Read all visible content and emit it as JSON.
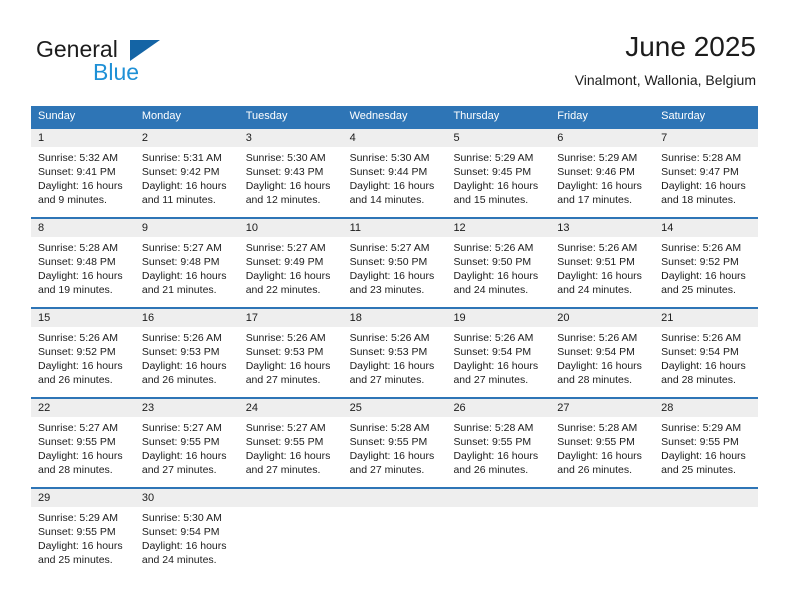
{
  "brand": {
    "name_top": "General",
    "name_bottom": "Blue",
    "mark": "triangle-logo-icon",
    "accent_top": "#1464a5",
    "accent_bottom": "#1e90d6"
  },
  "header": {
    "title": "June 2025",
    "subtitle": "Vinalmont, Wallonia, Belgium"
  },
  "theme": {
    "header_blue": "#2e75b6",
    "row_divider_blue": "#2e75b6",
    "daynum_band": "#eeeeee",
    "cell_background": "#ffffff",
    "text": "#1c1c1c"
  },
  "calendar": {
    "weekdays": [
      "Sunday",
      "Monday",
      "Tuesday",
      "Wednesday",
      "Thursday",
      "Friday",
      "Saturday"
    ],
    "weeks": [
      {
        "days": [
          {
            "num": "1",
            "l1": "Sunrise: 5:32 AM",
            "l2": "Sunset: 9:41 PM",
            "l3": "Daylight: 16 hours",
            "l4": "and 9 minutes."
          },
          {
            "num": "2",
            "l1": "Sunrise: 5:31 AM",
            "l2": "Sunset: 9:42 PM",
            "l3": "Daylight: 16 hours",
            "l4": "and 11 minutes."
          },
          {
            "num": "3",
            "l1": "Sunrise: 5:30 AM",
            "l2": "Sunset: 9:43 PM",
            "l3": "Daylight: 16 hours",
            "l4": "and 12 minutes."
          },
          {
            "num": "4",
            "l1": "Sunrise: 5:30 AM",
            "l2": "Sunset: 9:44 PM",
            "l3": "Daylight: 16 hours",
            "l4": "and 14 minutes."
          },
          {
            "num": "5",
            "l1": "Sunrise: 5:29 AM",
            "l2": "Sunset: 9:45 PM",
            "l3": "Daylight: 16 hours",
            "l4": "and 15 minutes."
          },
          {
            "num": "6",
            "l1": "Sunrise: 5:29 AM",
            "l2": "Sunset: 9:46 PM",
            "l3": "Daylight: 16 hours",
            "l4": "and 17 minutes."
          },
          {
            "num": "7",
            "l1": "Sunrise: 5:28 AM",
            "l2": "Sunset: 9:47 PM",
            "l3": "Daylight: 16 hours",
            "l4": "and 18 minutes."
          }
        ]
      },
      {
        "days": [
          {
            "num": "8",
            "l1": "Sunrise: 5:28 AM",
            "l2": "Sunset: 9:48 PM",
            "l3": "Daylight: 16 hours",
            "l4": "and 19 minutes."
          },
          {
            "num": "9",
            "l1": "Sunrise: 5:27 AM",
            "l2": "Sunset: 9:48 PM",
            "l3": "Daylight: 16 hours",
            "l4": "and 21 minutes."
          },
          {
            "num": "10",
            "l1": "Sunrise: 5:27 AM",
            "l2": "Sunset: 9:49 PM",
            "l3": "Daylight: 16 hours",
            "l4": "and 22 minutes."
          },
          {
            "num": "11",
            "l1": "Sunrise: 5:27 AM",
            "l2": "Sunset: 9:50 PM",
            "l3": "Daylight: 16 hours",
            "l4": "and 23 minutes."
          },
          {
            "num": "12",
            "l1": "Sunrise: 5:26 AM",
            "l2": "Sunset: 9:50 PM",
            "l3": "Daylight: 16 hours",
            "l4": "and 24 minutes."
          },
          {
            "num": "13",
            "l1": "Sunrise: 5:26 AM",
            "l2": "Sunset: 9:51 PM",
            "l3": "Daylight: 16 hours",
            "l4": "and 24 minutes."
          },
          {
            "num": "14",
            "l1": "Sunrise: 5:26 AM",
            "l2": "Sunset: 9:52 PM",
            "l3": "Daylight: 16 hours",
            "l4": "and 25 minutes."
          }
        ]
      },
      {
        "days": [
          {
            "num": "15",
            "l1": "Sunrise: 5:26 AM",
            "l2": "Sunset: 9:52 PM",
            "l3": "Daylight: 16 hours",
            "l4": "and 26 minutes."
          },
          {
            "num": "16",
            "l1": "Sunrise: 5:26 AM",
            "l2": "Sunset: 9:53 PM",
            "l3": "Daylight: 16 hours",
            "l4": "and 26 minutes."
          },
          {
            "num": "17",
            "l1": "Sunrise: 5:26 AM",
            "l2": "Sunset: 9:53 PM",
            "l3": "Daylight: 16 hours",
            "l4": "and 27 minutes."
          },
          {
            "num": "18",
            "l1": "Sunrise: 5:26 AM",
            "l2": "Sunset: 9:53 PM",
            "l3": "Daylight: 16 hours",
            "l4": "and 27 minutes."
          },
          {
            "num": "19",
            "l1": "Sunrise: 5:26 AM",
            "l2": "Sunset: 9:54 PM",
            "l3": "Daylight: 16 hours",
            "l4": "and 27 minutes."
          },
          {
            "num": "20",
            "l1": "Sunrise: 5:26 AM",
            "l2": "Sunset: 9:54 PM",
            "l3": "Daylight: 16 hours",
            "l4": "and 28 minutes."
          },
          {
            "num": "21",
            "l1": "Sunrise: 5:26 AM",
            "l2": "Sunset: 9:54 PM",
            "l3": "Daylight: 16 hours",
            "l4": "and 28 minutes."
          }
        ]
      },
      {
        "days": [
          {
            "num": "22",
            "l1": "Sunrise: 5:27 AM",
            "l2": "Sunset: 9:55 PM",
            "l3": "Daylight: 16 hours",
            "l4": "and 28 minutes."
          },
          {
            "num": "23",
            "l1": "Sunrise: 5:27 AM",
            "l2": "Sunset: 9:55 PM",
            "l3": "Daylight: 16 hours",
            "l4": "and 27 minutes."
          },
          {
            "num": "24",
            "l1": "Sunrise: 5:27 AM",
            "l2": "Sunset: 9:55 PM",
            "l3": "Daylight: 16 hours",
            "l4": "and 27 minutes."
          },
          {
            "num": "25",
            "l1": "Sunrise: 5:28 AM",
            "l2": "Sunset: 9:55 PM",
            "l3": "Daylight: 16 hours",
            "l4": "and 27 minutes."
          },
          {
            "num": "26",
            "l1": "Sunrise: 5:28 AM",
            "l2": "Sunset: 9:55 PM",
            "l3": "Daylight: 16 hours",
            "l4": "and 26 minutes."
          },
          {
            "num": "27",
            "l1": "Sunrise: 5:28 AM",
            "l2": "Sunset: 9:55 PM",
            "l3": "Daylight: 16 hours",
            "l4": "and 26 minutes."
          },
          {
            "num": "28",
            "l1": "Sunrise: 5:29 AM",
            "l2": "Sunset: 9:55 PM",
            "l3": "Daylight: 16 hours",
            "l4": "and 25 minutes."
          }
        ]
      },
      {
        "days": [
          {
            "num": "29",
            "l1": "Sunrise: 5:29 AM",
            "l2": "Sunset: 9:55 PM",
            "l3": "Daylight: 16 hours",
            "l4": "and 25 minutes."
          },
          {
            "num": "30",
            "l1": "Sunrise: 5:30 AM",
            "l2": "Sunset: 9:54 PM",
            "l3": "Daylight: 16 hours",
            "l4": "and 24 minutes."
          },
          {
            "num": "",
            "l1": "",
            "l2": "",
            "l3": "",
            "l4": ""
          },
          {
            "num": "",
            "l1": "",
            "l2": "",
            "l3": "",
            "l4": ""
          },
          {
            "num": "",
            "l1": "",
            "l2": "",
            "l3": "",
            "l4": ""
          },
          {
            "num": "",
            "l1": "",
            "l2": "",
            "l3": "",
            "l4": ""
          },
          {
            "num": "",
            "l1": "",
            "l2": "",
            "l3": "",
            "l4": ""
          }
        ]
      }
    ]
  }
}
